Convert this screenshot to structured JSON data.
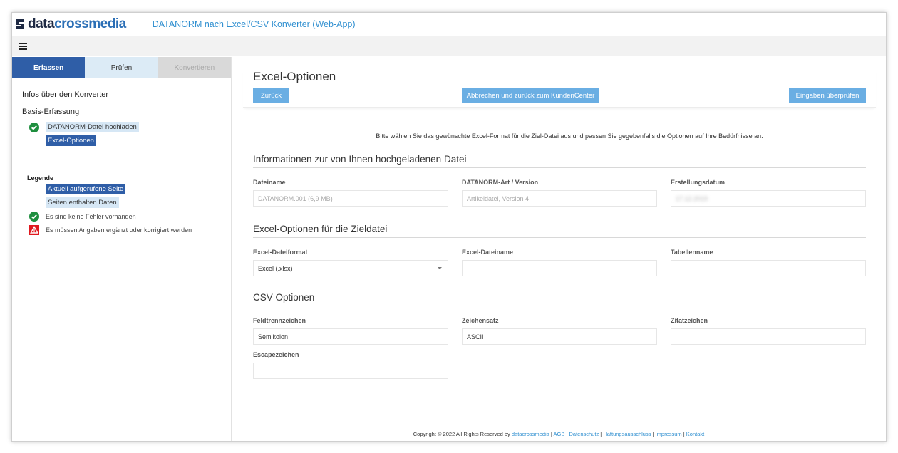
{
  "header": {
    "logo_part1": "data",
    "logo_part2": "crossmedia",
    "app_title": "DATANORM nach Excel/CSV Konverter (Web-App)"
  },
  "menu": {
    "icon": "hamburger-menu-icon"
  },
  "tabs": [
    {
      "label": "Erfassen",
      "state": "active"
    },
    {
      "label": "Prüfen",
      "state": "enabled"
    },
    {
      "label": "Konvertieren",
      "state": "disabled"
    }
  ],
  "sidebar": {
    "heading": "Infos über den Konverter",
    "section": "Basis-Erfassung",
    "steps": [
      {
        "label": "DATANORM-Datei hochladen",
        "icon": "check-circle-icon"
      },
      {
        "label": "Excel-Optionen",
        "icon": ""
      }
    ],
    "legend": {
      "title": "Legende",
      "current_page": "Aktuell aufgerufene Seite",
      "has_data": "Seiten enthalten Daten",
      "no_errors": "Es sind keine Fehler vorhanden",
      "needs_input": "Es müssen Angaben ergänzt oder korrigiert werden"
    }
  },
  "main": {
    "title": "Excel-Optionen",
    "buttons": {
      "back": "Zurück",
      "cancel": "Abbrechen und zurück zum KundenCenter",
      "check": "Eingaben überprüfen"
    },
    "intro": "Bitte wählen Sie das gewünschte Excel-Format für die Ziel-Datei aus und passen Sie gegebenfalls die Optionen auf Ihre Bedürfnisse an.",
    "file_info": {
      "title": "Informationen zur von Ihnen hochgeladenen Datei",
      "filename_label": "Dateiname",
      "filename_value": "DATANORM.001 (6,9 MB)",
      "type_label": "DATANORM-Art / Version",
      "type_value": "Artikeldatei, Version 4",
      "date_label": "Erstellungsdatum",
      "date_value": "17.12.2019"
    },
    "excel_options": {
      "title": "Excel-Optionen für die Zieldatei",
      "format_label": "Excel-Dateiformat",
      "format_value": "Excel (.xlsx)",
      "filename_label": "Excel-Dateiname",
      "filename_value": "",
      "sheet_label": "Tabellenname",
      "sheet_value": ""
    },
    "csv_options": {
      "title": "CSV Optionen",
      "separator_label": "Feldtrennzeichen",
      "separator_value": "Semikolon",
      "charset_label": "Zeichensatz",
      "charset_value": "ASCII",
      "quote_label": "Zitatzeichen",
      "quote_value": "",
      "escape_label": "Escapezeichen",
      "escape_value": ""
    }
  },
  "footer": {
    "copyright": "Copyright © 2022 All Rights Reserved by ",
    "links": [
      "datacrossmedia",
      "AGB",
      "Datenschutz",
      "Haftungsausschluss",
      "Impressum",
      "Kontakt"
    ],
    "separator": " | "
  },
  "colors": {
    "primary": "#2f5ea7",
    "button": "#6aaee3",
    "link": "#2f8fd0",
    "success": "#1e8e3e",
    "error": "#e0191f"
  }
}
